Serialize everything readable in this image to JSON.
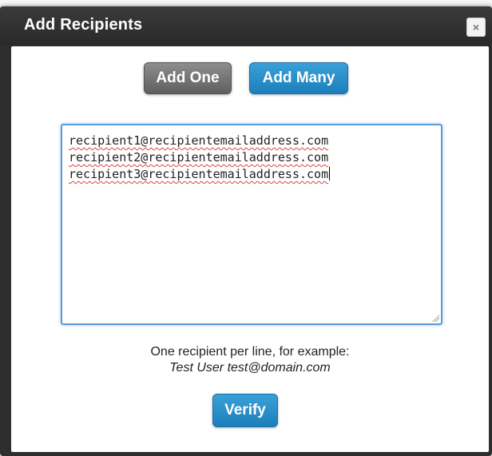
{
  "dialog": {
    "title": "Add Recipients",
    "close_icon": "close-icon",
    "close_glyph": "×"
  },
  "tabs": {
    "add_one_label": "Add One",
    "add_many_label": "Add Many",
    "active": "Add Many"
  },
  "recipients_input": {
    "lines": [
      "recipient1@recipientemailaddress.com",
      "recipient2@recipientemailaddress.com",
      "recipient3@recipientemailaddress.com"
    ]
  },
  "hint": {
    "line1": "One recipient per line, for example:",
    "example": "Test User test@domain.com"
  },
  "actions": {
    "verify_label": "Verify"
  },
  "colors": {
    "accent": "#1c7fbb",
    "title_bar": "#2e2e2e",
    "inactive_button": "#6e6e6e",
    "focus_border": "#5b9bd5"
  }
}
